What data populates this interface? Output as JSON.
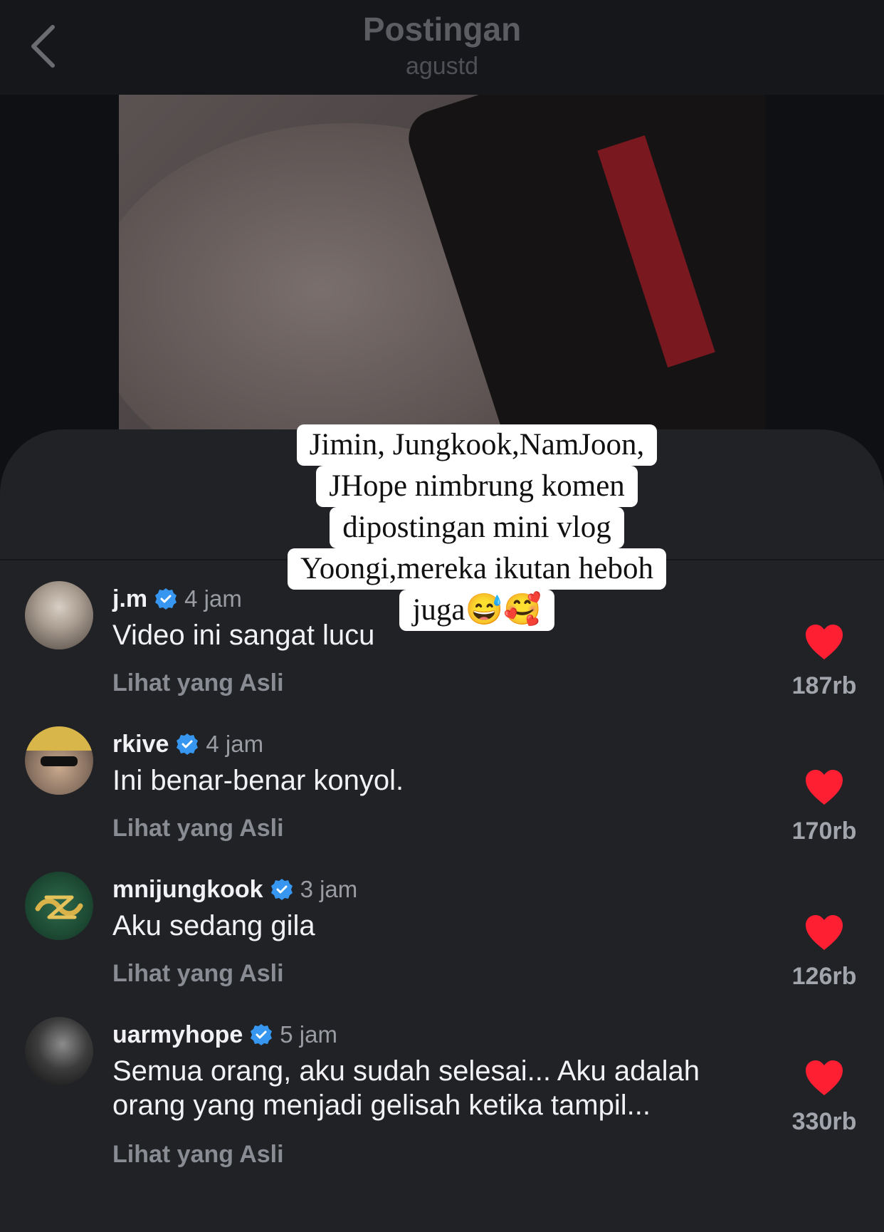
{
  "header": {
    "title": "Postingan",
    "subtitle": "agustd"
  },
  "caption": {
    "lines": [
      "Jimin, Jungkook,NamJoon,",
      "JHope nimbrung komen",
      "dipostingan mini vlog",
      "Yoongi,mereka ikutan heboh",
      "juga😅🥰"
    ]
  },
  "comments": [
    {
      "username": "j.m",
      "time": "4 jam",
      "text": "Video ini sangat lucu",
      "view_original": "Lihat yang Asli",
      "likes": "187rb"
    },
    {
      "username": "rkive",
      "time": "4 jam",
      "text": "Ini benar-benar konyol.",
      "view_original": "Lihat yang Asli",
      "likes": "170rb"
    },
    {
      "username": "mnijungkook",
      "time": "3 jam",
      "text": "Aku sedang gila",
      "view_original": "Lihat yang Asli",
      "likes": "126rb"
    },
    {
      "username": "uarmyhope",
      "time": "5 jam",
      "text": "Semua orang, aku sudah selesai... Aku adalah orang yang menjadi gelisah ketika tampil...",
      "view_original": "Lihat yang Asli",
      "likes": "330rb"
    }
  ],
  "colors": {
    "like": "#ff1f33",
    "verified": "#3797f0"
  }
}
